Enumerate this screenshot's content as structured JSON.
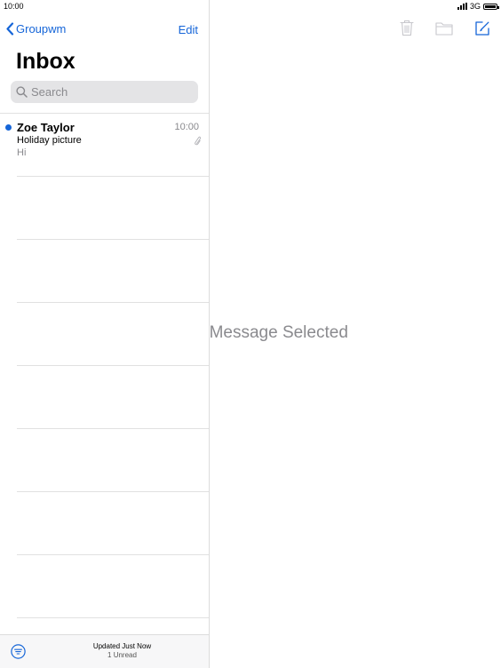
{
  "status": {
    "time": "10:00",
    "network": "3G"
  },
  "sidebar": {
    "back_label": "Groupwm",
    "edit_label": "Edit",
    "title": "Inbox",
    "search_placeholder": "Search"
  },
  "messages": [
    {
      "sender": "Zoe Taylor",
      "time": "10:00",
      "subject": "Holiday picture",
      "preview": "Hi",
      "unread": true,
      "attachment": true
    }
  ],
  "bottom": {
    "updated": "Updated Just Now",
    "unread": "1 Unread"
  },
  "detail": {
    "empty_text": "No Message Selected"
  },
  "colors": {
    "accent": "#1565d8",
    "secondary_text": "#8a8a8e",
    "icon_disabled": "#c7c7cc"
  },
  "icons": [
    "chevron-left-icon",
    "search-icon",
    "paperclip-icon",
    "filter-icon",
    "trash-icon",
    "folder-icon",
    "compose-icon",
    "signal-icon",
    "battery-icon"
  ]
}
